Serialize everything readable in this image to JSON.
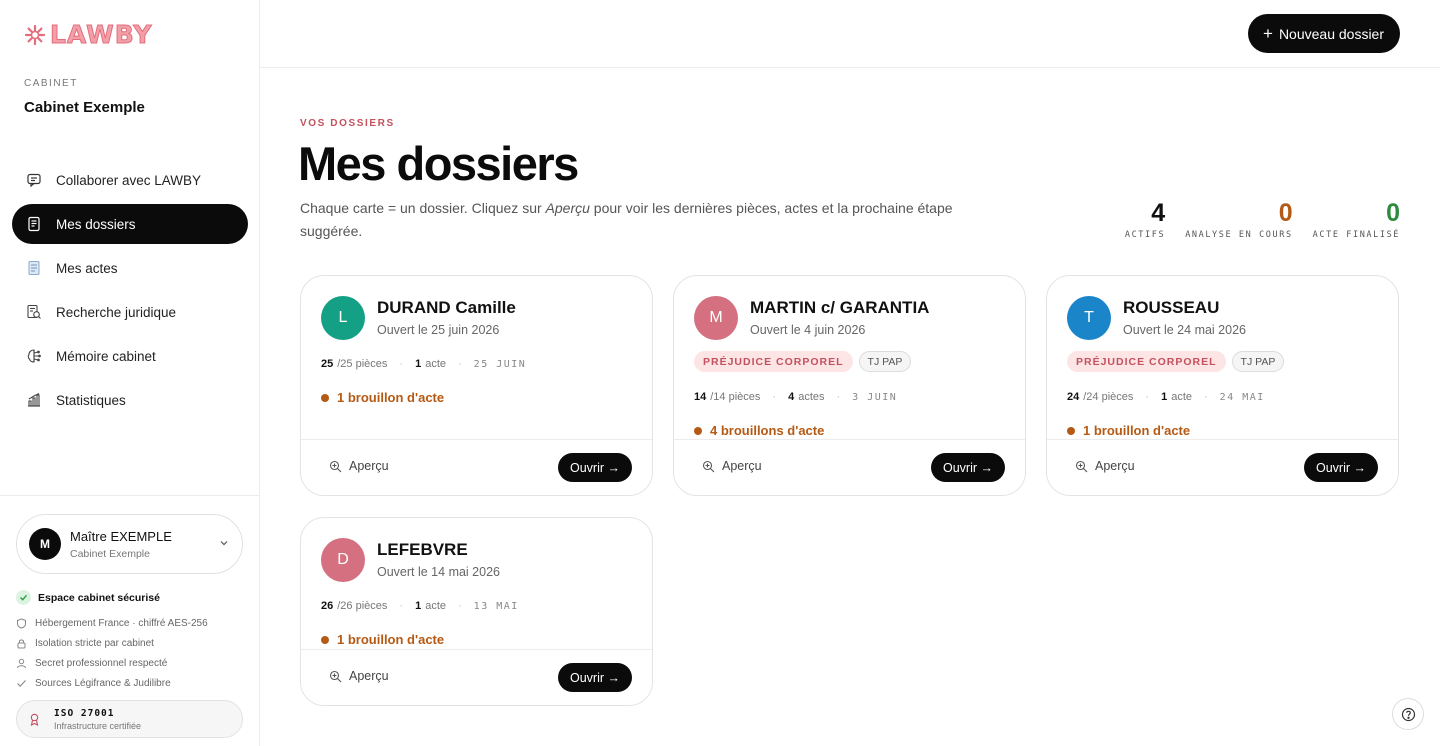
{
  "brand": {
    "name": "LAWBY",
    "color": "#e46d7c"
  },
  "sidebar": {
    "cabinet_label": "CABINET",
    "cabinet_name": "Cabinet Exemple",
    "nav": [
      {
        "label": "Collaborer avec LAWBY",
        "icon": "chat-bubble-icon",
        "active": false
      },
      {
        "label": "Mes dossiers",
        "icon": "folder-document-icon",
        "active": true
      },
      {
        "label": "Mes actes",
        "icon": "document-icon",
        "active": false
      },
      {
        "label": "Recherche juridique",
        "icon": "search-document-icon",
        "active": false
      },
      {
        "label": "Mémoire cabinet",
        "icon": "brain-icon",
        "active": false
      },
      {
        "label": "Statistiques",
        "icon": "bar-chart-icon",
        "active": false
      }
    ],
    "user": {
      "initial": "M",
      "name": "Maître EXEMPLE",
      "cabinet": "Cabinet Exemple"
    },
    "security": {
      "title": "Espace cabinet sécurisé",
      "items": [
        {
          "label": "Hébergement France · chiffré AES-256",
          "icon": "shield-icon"
        },
        {
          "label": "Isolation stricte par cabinet",
          "icon": "lock-icon"
        },
        {
          "label": "Secret professionnel respecté",
          "icon": "user-icon"
        },
        {
          "label": "Sources Légifrance & Judilibre",
          "icon": "check-icon"
        }
      ]
    },
    "iso": {
      "title": "ISO 27001",
      "subtitle": "Infrastructure certifiée"
    }
  },
  "topbar": {
    "new_button": "Nouveau dossier"
  },
  "main": {
    "eyebrow": "VOS DOSSIERS",
    "title": "Mes dossiers",
    "desc_before": "Chaque carte = un dossier. Cliquez sur ",
    "desc_em": "Aperçu",
    "desc_after": " pour voir les dernières pièces, actes et la prochaine étape suggérée.",
    "stats": [
      {
        "value": "4",
        "label": "ACTIFS",
        "color": "#111111"
      },
      {
        "value": "0",
        "label": "ANALYSE EN COURS",
        "color": "#b55a14"
      },
      {
        "value": "0",
        "label": "ACTE FINALISÉ",
        "color": "#2e8b3e"
      }
    ]
  },
  "cards": [
    {
      "initial": "L",
      "name": "DURAND Camille",
      "opened": "Ouvert le 25 juin 2026",
      "tags": [],
      "pieces_count": "25",
      "pieces_total": "/25 pièces",
      "actes_count": "1",
      "actes_label": "acte",
      "date": "25 JUIN",
      "draft": "1 brouillon d'acte",
      "avatar_color": "#14a085",
      "preview": "Aperçu",
      "open": "Ouvrir →"
    },
    {
      "initial": "M",
      "name": "MARTIN c/ GARANTIA",
      "opened": "Ouvert le 4 juin 2026",
      "tags": [
        "PRÉJUDICE CORPOREL",
        "TJ PAP"
      ],
      "pieces_count": "14",
      "pieces_total": "/14 pièces",
      "actes_count": "4",
      "actes_label": "actes",
      "date": "3 JUIN",
      "draft": "4 brouillons d'acte",
      "avatar_color": "#d4707f",
      "preview": "Aperçu",
      "open": "Ouvrir →"
    },
    {
      "initial": "T",
      "name": "ROUSSEAU",
      "opened": "Ouvert le 24 mai 2026",
      "tags": [
        "PRÉJUDICE CORPOREL",
        "TJ PAP"
      ],
      "pieces_count": "24",
      "pieces_total": "/24 pièces",
      "actes_count": "1",
      "actes_label": "acte",
      "date": "24 MAI",
      "draft": "1 brouillon d'acte",
      "avatar_color": "#1a86c9",
      "preview": "Aperçu",
      "open": "Ouvrir →"
    },
    {
      "initial": "D",
      "name": "LEFEBVRE",
      "opened": "Ouvert le 14 mai 2026",
      "tags": [],
      "pieces_count": "26",
      "pieces_total": "/26 pièces",
      "actes_count": "1",
      "actes_label": "acte",
      "date": "13 MAI",
      "draft": "1 brouillon d'acte",
      "avatar_color": "#d4707f",
      "preview": "Aperçu",
      "open": "Ouvrir →"
    }
  ]
}
